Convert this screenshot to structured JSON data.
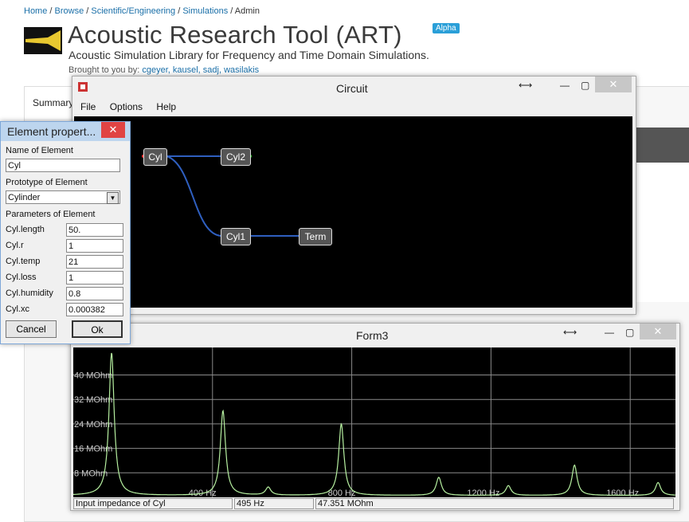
{
  "breadcrumb": [
    "Home",
    "Browse",
    "Scientific/Engineering",
    "Simulations",
    "Admin"
  ],
  "project": {
    "title": "Acoustic Research Tool (ART)",
    "badge": "Alpha",
    "subtitle": "Acoustic Simulation Library for Frequency and Time Domain Simulations.",
    "brought_prefix": "Brought to you by:",
    "authors": "cgeyer, kausel, sadj, wasilakis",
    "tab": "Summary"
  },
  "circuit": {
    "title": "Circuit",
    "menu": [
      "File",
      "Options",
      "Help"
    ],
    "nodes": [
      "Cyl",
      "Cyl2",
      "Cyl1",
      "Term"
    ],
    "wire_color": "#2f5fbf"
  },
  "props": {
    "title": "Element propert...",
    "name_label": "Name of Element",
    "name_value": "Cyl",
    "proto_label": "Prototype of Element",
    "proto_value": "Cylinder",
    "params_label": "Parameters of Element",
    "params": [
      {
        "name": "Cyl.length",
        "value": "50."
      },
      {
        "name": "Cyl.r",
        "value": "1"
      },
      {
        "name": "Cyl.temp",
        "value": "21"
      },
      {
        "name": "Cyl.loss",
        "value": "1"
      },
      {
        "name": "Cyl.humidity",
        "value": "0.8"
      },
      {
        "name": "Cyl.xc",
        "value": "0.000382"
      }
    ],
    "cancel": "Cancel",
    "ok": "Ok"
  },
  "form3": {
    "title": "Form3",
    "status": [
      "Input impedance of Cyl",
      "495 Hz",
      "47.351 MOhm"
    ]
  },
  "chart_data": {
    "type": "line",
    "title": "",
    "line_color": "#b6f0a0",
    "grid_color": "#8a8a8a",
    "y_ticks": [
      "8 MOhm",
      "16 MOhm",
      "24 MOhm",
      "32 MOhm",
      "40 MOhm"
    ],
    "y_tick_values": [
      8,
      16,
      24,
      32,
      40
    ],
    "x_ticks": [
      "400 Hz",
      "800 Hz",
      "1200 Hz",
      "1600 Hz"
    ],
    "x_tick_values": [
      400,
      800,
      1200,
      1600
    ],
    "xlim": [
      0,
      1730
    ],
    "ylim": [
      0,
      49
    ],
    "peaks": [
      {
        "x": 110,
        "y": 47.3
      },
      {
        "x": 430,
        "y": 28.3
      },
      {
        "x": 560,
        "y": 3.2
      },
      {
        "x": 770,
        "y": 24.0
      },
      {
        "x": 1050,
        "y": 6.5
      },
      {
        "x": 1250,
        "y": 3.8
      },
      {
        "x": 1440,
        "y": 10.5
      },
      {
        "x": 1680,
        "y": 4.8
      }
    ]
  }
}
